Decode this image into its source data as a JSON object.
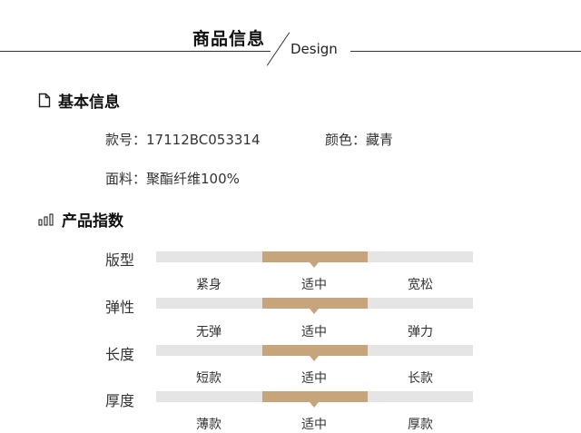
{
  "header": {
    "title": "商品信息",
    "subtitle": "Design"
  },
  "basic": {
    "title": "基本信息",
    "icon": "document-icon",
    "item_no_label": "款号：",
    "item_no_value": "17112BC053314",
    "color_label": "颜色：",
    "color_value": "藏青",
    "material_label": "面料：",
    "material_value": "聚酯纤维100%"
  },
  "index": {
    "title": "产品指数",
    "icon": "bar-chart-icon",
    "accent_color": "#c6a57c",
    "track_color": "#e5e5e5",
    "rows": [
      {
        "label": "版型",
        "options": [
          "紧身",
          "适中",
          "宽松"
        ],
        "selected": "适中"
      },
      {
        "label": "弹性",
        "options": [
          "无弹",
          "适中",
          "弹力"
        ],
        "selected": "适中"
      },
      {
        "label": "长度",
        "options": [
          "短款",
          "适中",
          "长款"
        ],
        "selected": "适中"
      },
      {
        "label": "厚度",
        "options": [
          "薄款",
          "适中",
          "厚款"
        ],
        "selected": "适中"
      }
    ]
  }
}
